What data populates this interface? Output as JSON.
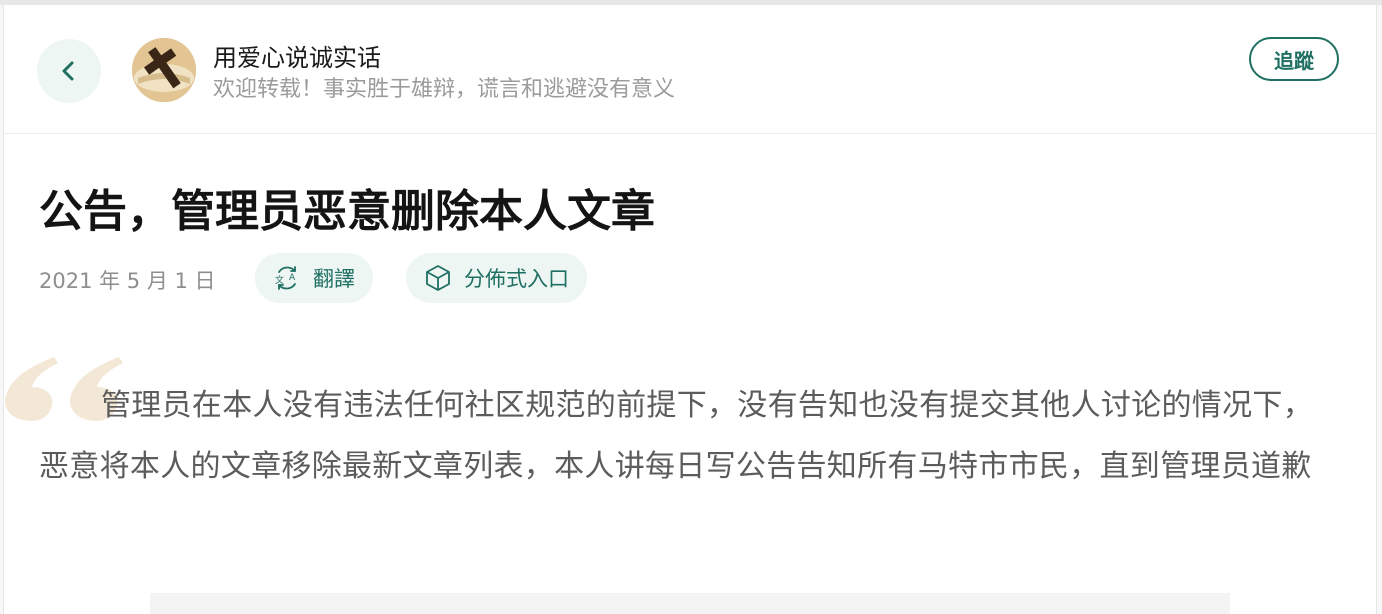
{
  "header": {
    "author_name": "用爱心说诚实话",
    "author_bio": "欢迎转载！事实胜于雄辩，谎言和逃避没有意义",
    "follow_label": "追蹤"
  },
  "article": {
    "title": "公告，管理员恶意删除本人文章",
    "date": "2021 年 5 月 1 日",
    "translate_label": "翻譯",
    "distributed_label": "分佈式入口",
    "quote": "管理员在本人没有违法任何社区规范的前提下，没有告知也没有提交其他人讨论的情况下，恶意将本人的文章移除最新文章列表，本人讲每日写公告告知所有马特市市民，直到管理员道歉"
  },
  "colors": {
    "accent": "#1f6f63",
    "chip_bg": "#eef6f4",
    "quote_mark": "#f3e8d6"
  },
  "icons": {
    "back": "chevron-left-icon",
    "translate": "translate-icon",
    "distributed": "cube-icon",
    "quote": "quote-mark-icon"
  }
}
